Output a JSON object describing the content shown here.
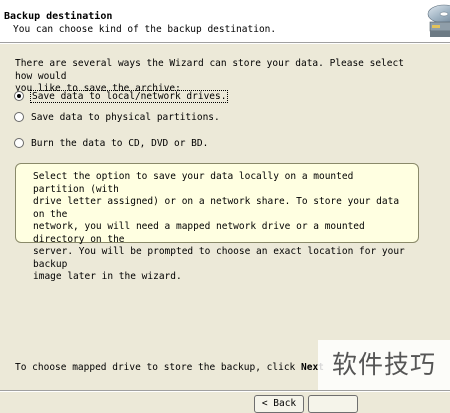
{
  "header": {
    "title": "Backup destination",
    "subtitle": "You can choose kind of the backup destination.",
    "icon": "backup-disc-icon"
  },
  "intro_text": "There are several ways the Wizard can store your data. Please select how would\nyou like to save the archive:",
  "options": [
    {
      "label": "Save data to local/network drives.",
      "checked": true,
      "focused": true
    },
    {
      "label": "Save data to physical partitions.",
      "checked": false,
      "focused": false
    },
    {
      "label": "Burn the data to CD, DVD or BD.",
      "checked": false,
      "focused": false
    }
  ],
  "note_text": "Select the option to save your data locally on a mounted partition (with\ndrive letter assigned) or on a network share. To store your data on the\nnetwork, you will need a mapped network drive or a mounted directory on the\nserver. You will be prompted to choose an exact location for your backup\nimage later in the wizard.",
  "footer": {
    "prefix": "To choose mapped drive to store the backup, click",
    "emphasis": "Next"
  },
  "buttons": {
    "back_label": "< Back"
  },
  "watermark": "软件技巧"
}
